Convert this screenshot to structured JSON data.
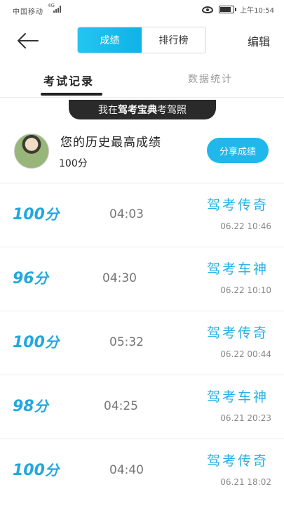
{
  "status": {
    "carrier": "中国移动",
    "network": "4G",
    "time": "上午10:54"
  },
  "header": {
    "segments": [
      "成绩",
      "排行榜"
    ],
    "edit_label": "编辑"
  },
  "tabs": [
    "考试记录",
    "数据统计"
  ],
  "banner": {
    "prefix": "我在",
    "brand": "驾考宝典",
    "suffix": "考驾照"
  },
  "best": {
    "title": "您的历史最高成绩",
    "score": "100分",
    "share_label": "分享成绩"
  },
  "records": [
    {
      "score": "100",
      "unit": "分",
      "time": "04:03",
      "rank": "驾考传奇",
      "date": "06.22 10:46"
    },
    {
      "score": "96",
      "unit": "分",
      "time": "04:30",
      "rank": "驾考车神",
      "date": "06.22 10:10"
    },
    {
      "score": "100",
      "unit": "分",
      "time": "05:32",
      "rank": "驾考传奇",
      "date": "06.22 00:44"
    },
    {
      "score": "98",
      "unit": "分",
      "time": "04:25",
      "rank": "驾考车神",
      "date": "06.21 20:23"
    },
    {
      "score": "100",
      "unit": "分",
      "time": "04:40",
      "rank": "驾考传奇",
      "date": "06.21 18:02"
    }
  ],
  "icons": {
    "back": "back-arrow-icon",
    "eye": "eye-icon",
    "battery": "battery-icon",
    "signal": "signal-icon"
  },
  "colors": {
    "accent": "#20b8ea",
    "score": "#22a8dc",
    "banner": "#2a2a2a"
  }
}
